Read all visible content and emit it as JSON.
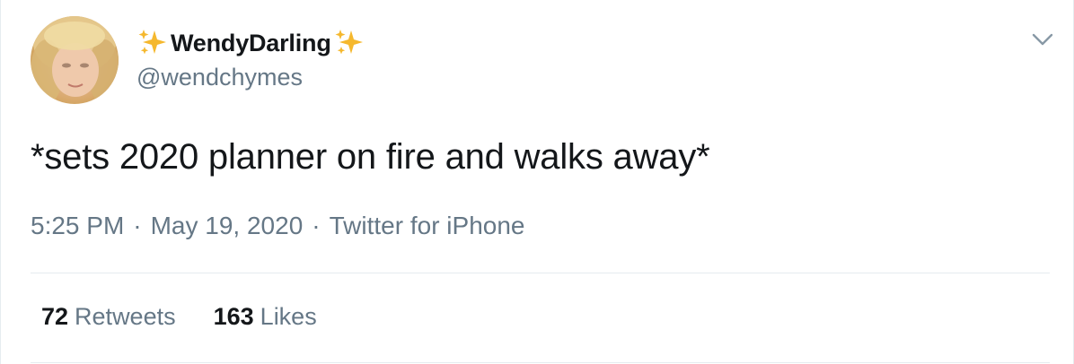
{
  "author": {
    "display_name": "WendyDarling",
    "handle": "@wendchymes",
    "avatar_icon": "profile-photo",
    "name_decoration_icon": "sparkles-emoji"
  },
  "tweet": {
    "text": "*sets 2020 planner on fire and walks away*",
    "time": "5:25 PM",
    "separator": "·",
    "date": "May 19, 2020",
    "source": "Twitter for iPhone"
  },
  "stats": {
    "retweets_count": "72",
    "retweets_label": "Retweets",
    "likes_count": "163",
    "likes_label": "Likes"
  },
  "menu": {
    "icon": "chevron-down-icon"
  },
  "colors": {
    "primary_text": "#14171a",
    "secondary_text": "#657786",
    "divider": "#e6ecf0",
    "sparkle": "#f5b82e"
  }
}
